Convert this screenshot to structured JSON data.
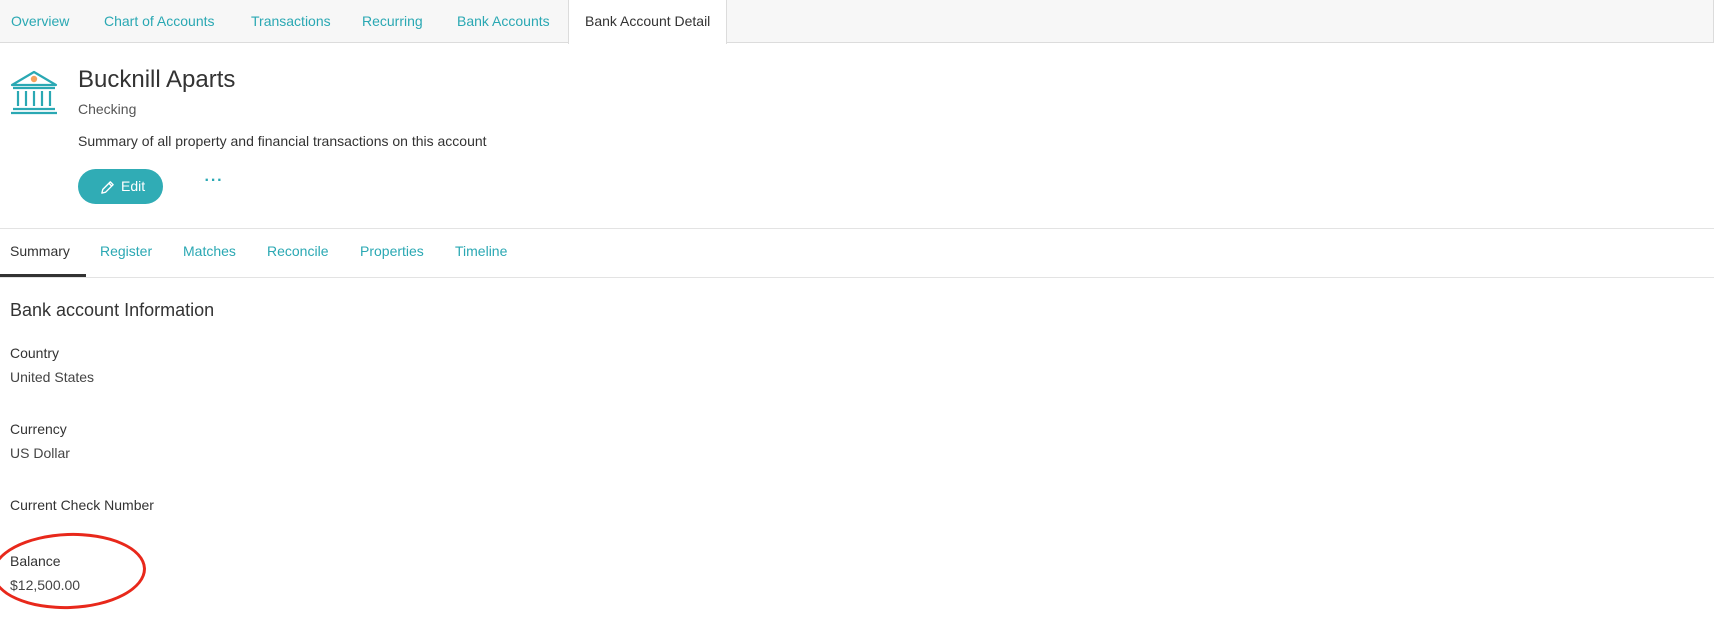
{
  "top_tabs": [
    {
      "label": "Overview"
    },
    {
      "label": "Chart of Accounts"
    },
    {
      "label": "Transactions"
    },
    {
      "label": "Recurring"
    },
    {
      "label": "Bank Accounts"
    },
    {
      "label": "Bank Account Detail",
      "active": true
    }
  ],
  "account": {
    "icon": "bank-building-icon",
    "name": "Bucknill Aparts",
    "type": "Checking",
    "description": "Summary of all property and financial transactions on this account"
  },
  "actions": {
    "edit_label": "Edit",
    "edit_icon": "pencil-icon",
    "more_label": "···",
    "more_icon": "ellipsis-icon"
  },
  "sub_tabs": [
    {
      "label": "Summary",
      "active": true
    },
    {
      "label": "Register"
    },
    {
      "label": "Matches"
    },
    {
      "label": "Reconcile"
    },
    {
      "label": "Properties"
    },
    {
      "label": "Timeline"
    }
  ],
  "info": {
    "title": "Bank account Information",
    "fields": [
      {
        "label": "Country",
        "value": "United States"
      },
      {
        "label": "Currency",
        "value": "US Dollar"
      },
      {
        "label": "Current Check Number",
        "value": ""
      },
      {
        "label": "Balance",
        "value": "$12,500.00"
      }
    ]
  },
  "colors": {
    "accent": "#2aa8b3",
    "button": "#30acb5",
    "annotation": "#e8281b"
  }
}
